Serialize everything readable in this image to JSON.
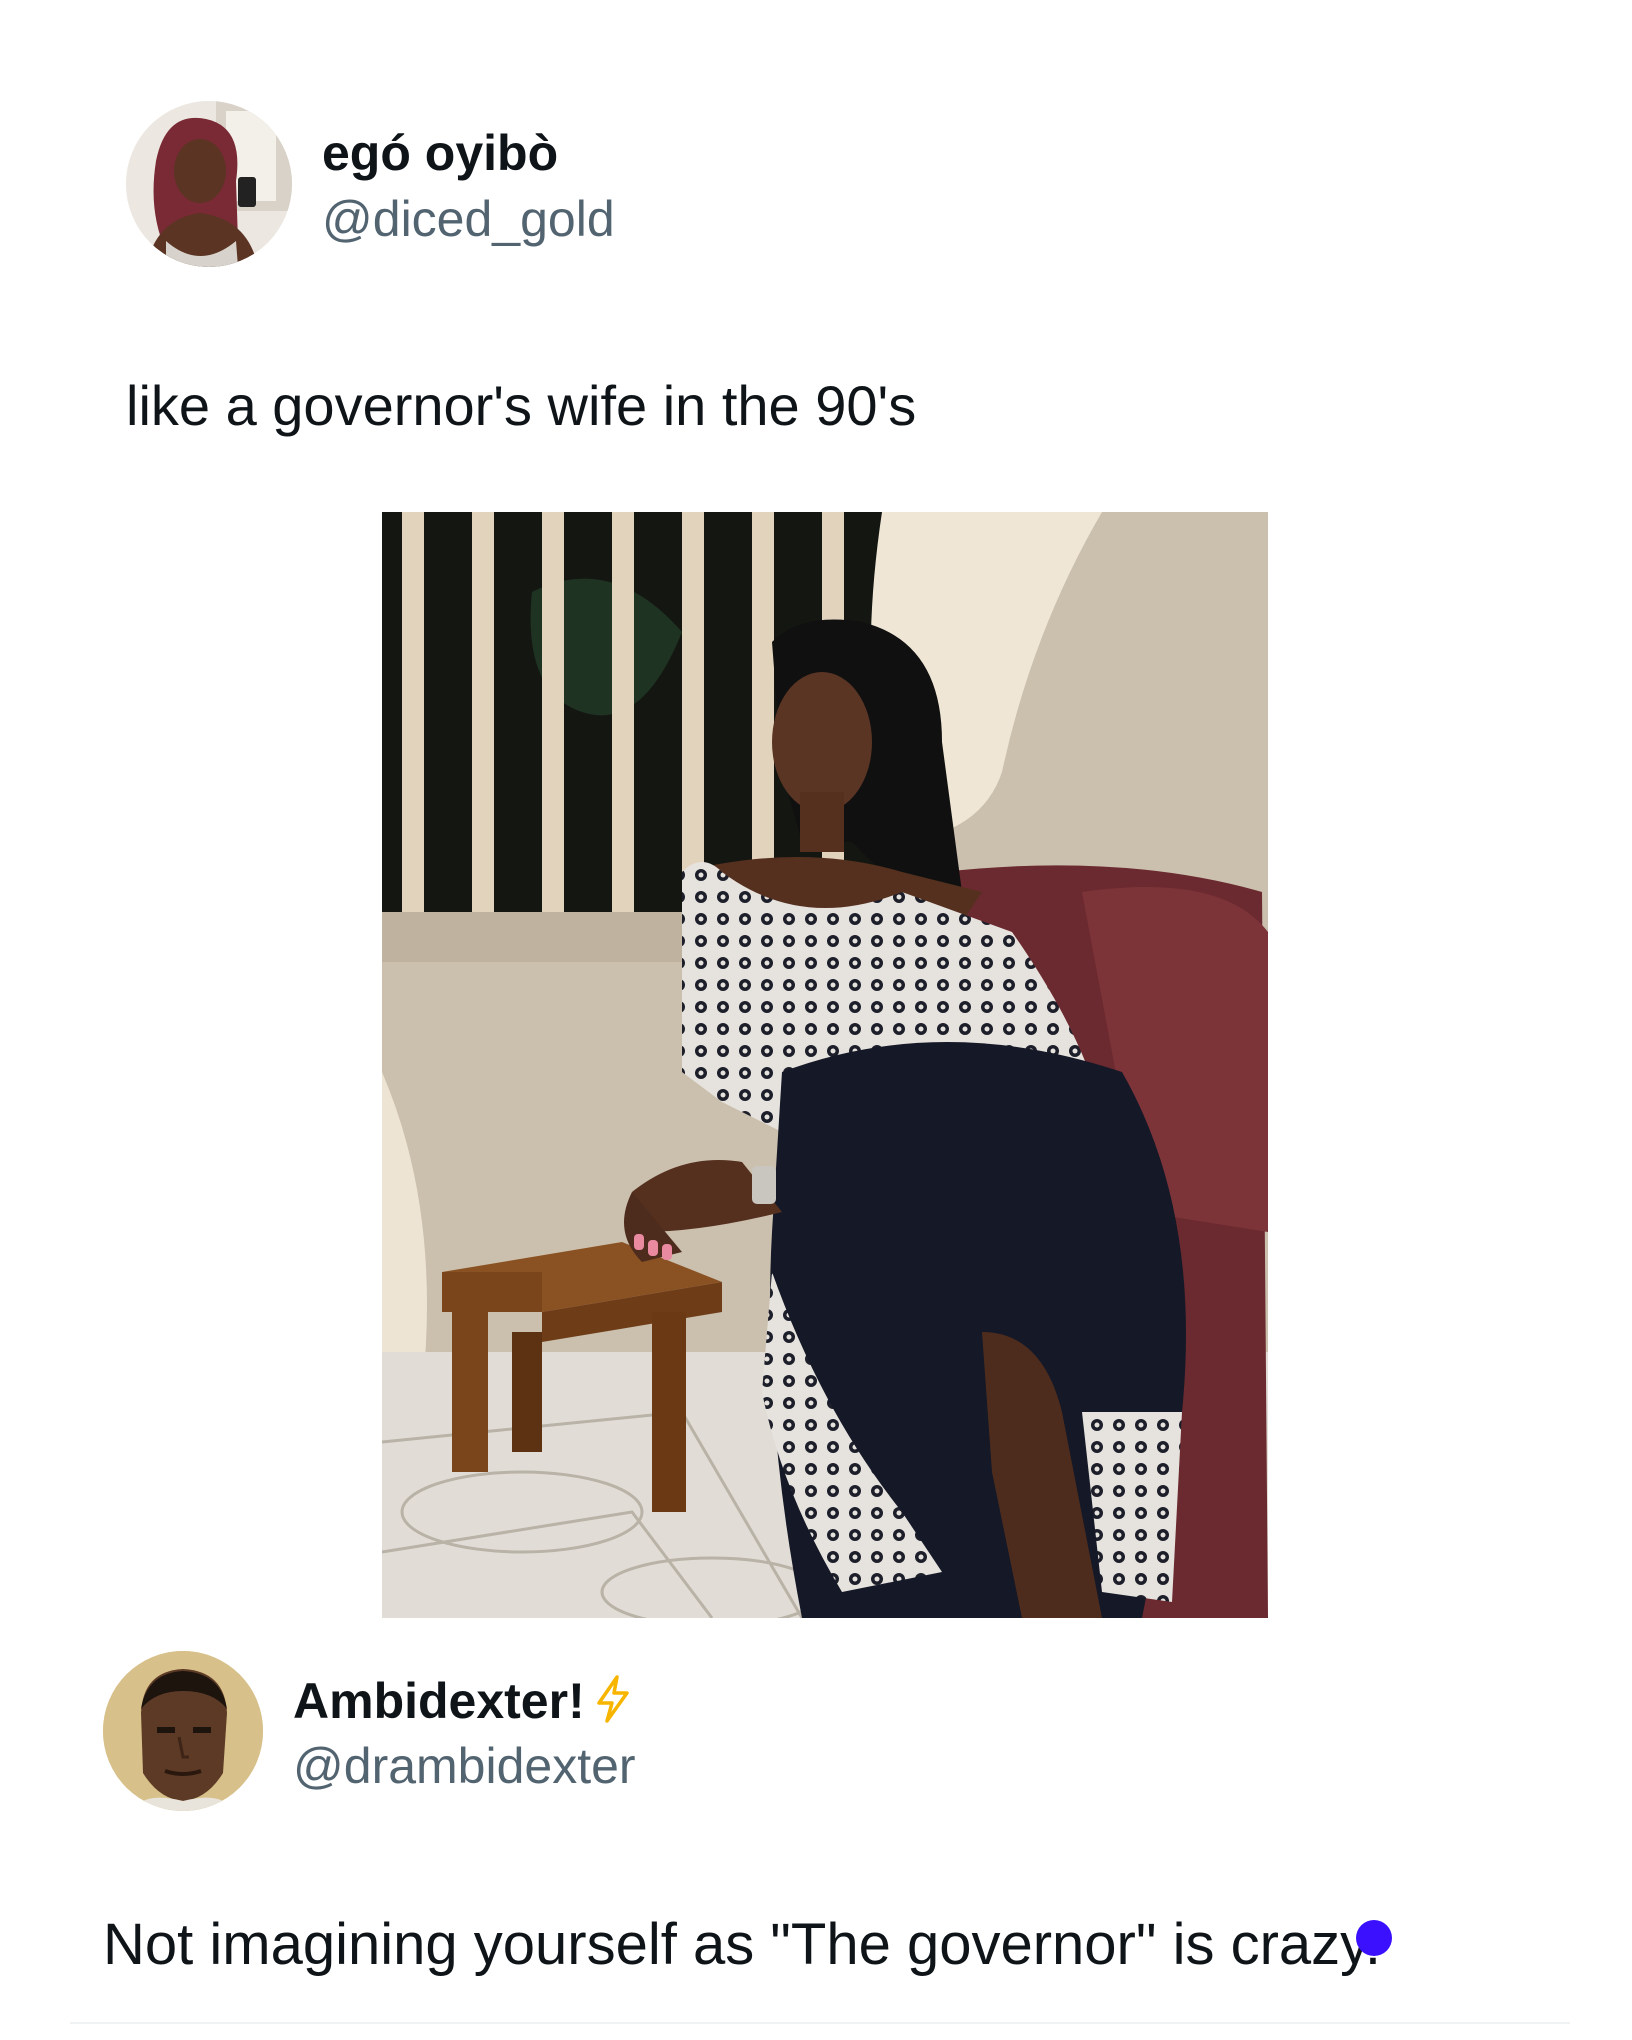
{
  "tweet": {
    "author": {
      "display_name": "egó oyibò",
      "handle": "@diced_gold"
    },
    "text": "like a governor's wife in the 90's",
    "media": {
      "kind": "photo"
    }
  },
  "reply": {
    "author": {
      "display_name": "Ambidexter!",
      "handle": "@drambidexter",
      "badge_icon": "lightning-bolt-icon",
      "badge_color": "#f7b500"
    },
    "text": "Not imagining yourself as \"The governor\" is crazy."
  },
  "colors": {
    "text_primary": "#0f1419",
    "text_secondary": "#536471",
    "marker_dot": "#3a10ff"
  }
}
